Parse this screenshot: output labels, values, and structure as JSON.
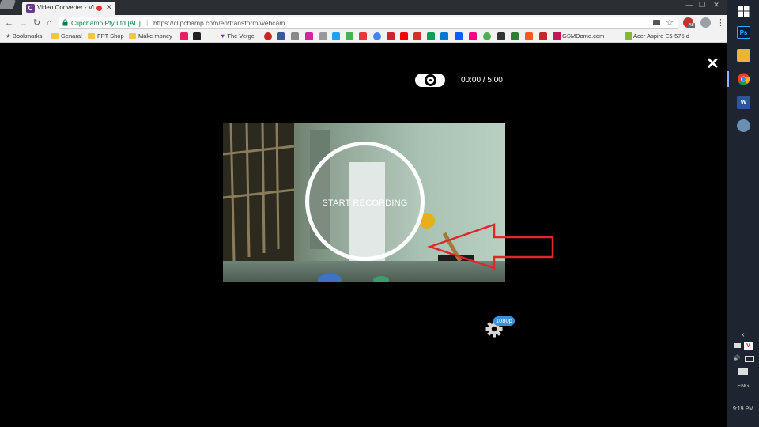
{
  "browser": {
    "tab_title": "Video Converter - Vi",
    "tab_favicon_letter": "C",
    "site_identity": "Clipchamp Pty Ltd [AU]",
    "url_separator": "|",
    "url": "https://clipchamp.com/en/transform/webcam",
    "bookmarks": {
      "bookmarks_label": "Bookmarks",
      "general": "Genaral",
      "fpt_shop": "FPT Shop",
      "make_money": "Make money",
      "verge": "The Verge",
      "gsmdome": "GSMDome.com",
      "acer": "Acer Aspire E5-575 d"
    },
    "ext_badge": "AB"
  },
  "recorder": {
    "timer": "00:00 / 5:00",
    "record_label": "START RECORDING",
    "resolution_badge": "1080p",
    "close_symbol": "✕"
  },
  "taskbar": {
    "photoshop_label": "Ps",
    "word_label": "W",
    "language": "ENG",
    "clock": "9:19 PM",
    "tray_v": "V"
  },
  "colors": {
    "annotation_red": "#e0262a",
    "badge_blue": "#3d8fd6",
    "secure_green": "#0b8043"
  }
}
